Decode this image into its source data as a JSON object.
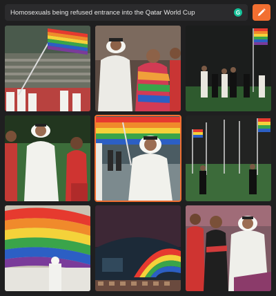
{
  "prompt": {
    "value": "Homosexuals being refused entrance into the Qatar World Cup"
  },
  "icons": {
    "grammar": "grammarly-icon",
    "generate": "pencil-icon"
  },
  "colors": {
    "accent": "#f26f31",
    "background": "#1f1f20",
    "input_bg": "#2b2b2d"
  },
  "results": {
    "count": 9,
    "selected_index": 4
  }
}
